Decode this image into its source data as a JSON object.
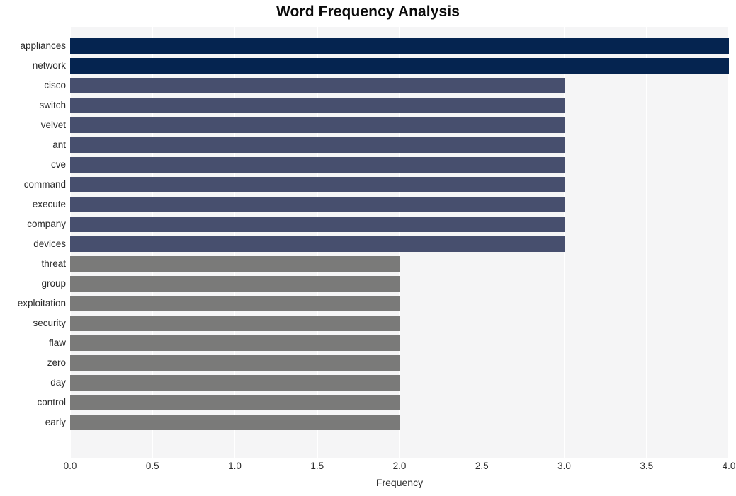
{
  "chart_data": {
    "type": "bar",
    "orientation": "horizontal",
    "title": "Word Frequency Analysis",
    "xlabel": "Frequency",
    "ylabel": "",
    "xlim": [
      0.0,
      4.0
    ],
    "xticks": [
      "0.0",
      "0.5",
      "1.0",
      "1.5",
      "2.0",
      "2.5",
      "3.0",
      "3.5",
      "4.0"
    ],
    "xtick_values": [
      0.0,
      0.5,
      1.0,
      1.5,
      2.0,
      2.5,
      3.0,
      3.5,
      4.0
    ],
    "grid": "vertical-white-on-light-gray",
    "legend": "none",
    "categories": [
      "appliances",
      "network",
      "cisco",
      "switch",
      "velvet",
      "ant",
      "cve",
      "command",
      "execute",
      "company",
      "devices",
      "threat",
      "group",
      "exploitation",
      "security",
      "flaw",
      "zero",
      "day",
      "control",
      "early"
    ],
    "values": [
      4,
      4,
      3,
      3,
      3,
      3,
      3,
      3,
      3,
      3,
      3,
      2,
      2,
      2,
      2,
      2,
      2,
      2,
      2,
      2
    ],
    "bar_colors": [
      "#052450",
      "#052450",
      "#474f6e",
      "#474f6e",
      "#474f6e",
      "#474f6e",
      "#474f6e",
      "#474f6e",
      "#474f6e",
      "#474f6e",
      "#474f6e",
      "#7a7a79",
      "#7a7a79",
      "#7a7a79",
      "#7a7a79",
      "#7a7a79",
      "#7a7a79",
      "#7a7a79",
      "#7a7a79",
      "#7a7a79"
    ]
  },
  "colors": {
    "navy": "#052450",
    "slate": "#474f6e",
    "gray": "#7a7a79",
    "plot_background": "#f5f5f6",
    "gridline": "#ffffff",
    "page_background": "#ffffff",
    "text": "#2b2b2b",
    "title_text": "#0a0a0a"
  }
}
